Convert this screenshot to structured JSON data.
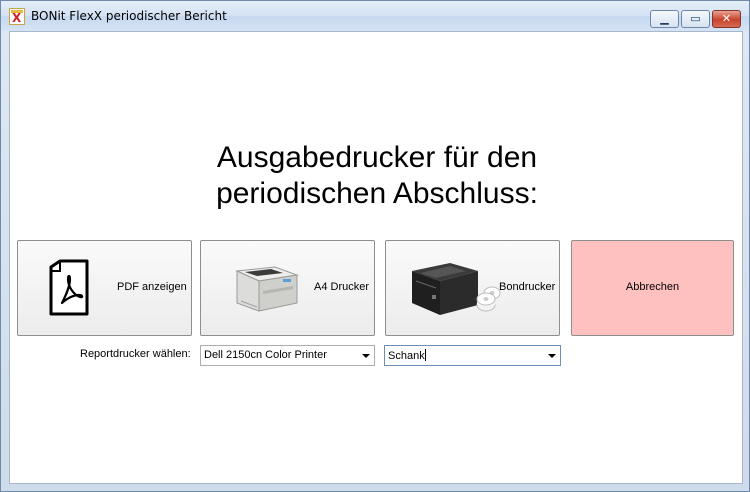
{
  "window": {
    "title": "BONit FlexX periodischer Bericht",
    "controls": [
      "minimize-icon",
      "maximize-icon",
      "close-icon"
    ]
  },
  "main": {
    "heading_line1": "Ausgabedrucker für den",
    "heading_line2": "periodischen Abschluss:",
    "options": {
      "pdf": "PDF anzeigen",
      "a4": "A4 Drucker",
      "bon": "Bondrucker",
      "cancel": "Abbrechen"
    },
    "report_label": "Reportdrucker wählen:",
    "printer_select": {
      "value": "Dell 2150cn Color Printer"
    },
    "bon_select": {
      "value": "Schank"
    }
  },
  "colors": {
    "cancel_bg": "#ffc0c0",
    "window_frame": "#cddbeb"
  }
}
